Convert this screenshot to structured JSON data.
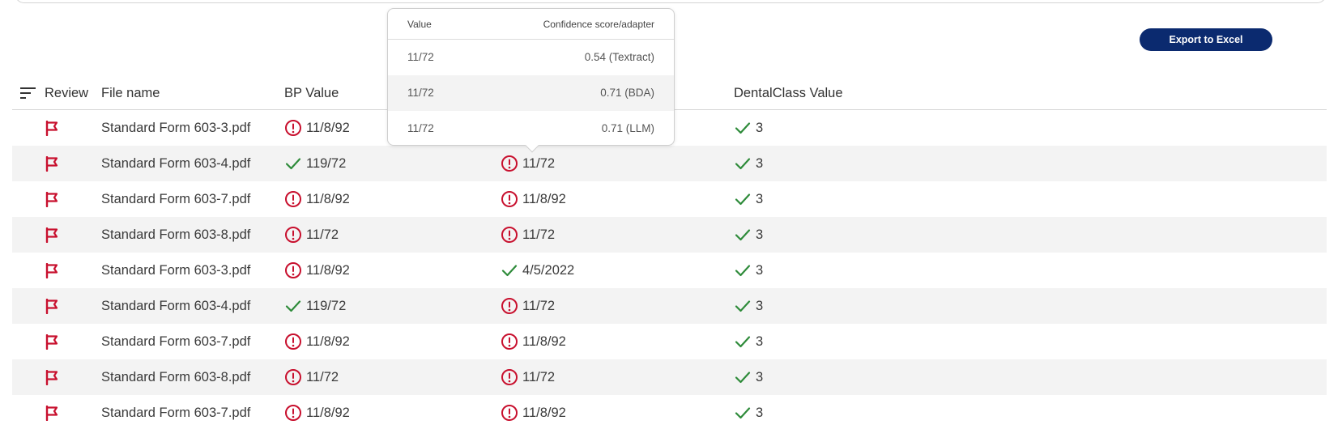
{
  "toolbar": {
    "export_label": "Export to Excel"
  },
  "colors": {
    "accent": "#0b2a6f",
    "flag": "#c8102e",
    "warning": "#c8102e",
    "success": "#2e8b3a"
  },
  "table": {
    "headers": {
      "review": "Review",
      "file_name": "File name",
      "bp_value": "BP Value",
      "dentalclass_value": "DentalClass Value"
    },
    "rows": [
      {
        "file": "Standard Form 603-3.pdf",
        "bp": {
          "status": "warning",
          "text": "11/8/92"
        },
        "col3": {
          "status": "",
          "text": ""
        },
        "dental": {
          "status": "success",
          "text": "3"
        }
      },
      {
        "file": "Standard Form 603-4.pdf",
        "bp": {
          "status": "success",
          "text": "119/72"
        },
        "col3": {
          "status": "warning",
          "text": "11/72"
        },
        "dental": {
          "status": "success",
          "text": "3"
        }
      },
      {
        "file": "Standard Form 603-7.pdf",
        "bp": {
          "status": "warning",
          "text": "11/8/92"
        },
        "col3": {
          "status": "warning",
          "text": "11/8/92"
        },
        "dental": {
          "status": "success",
          "text": "3"
        }
      },
      {
        "file": "Standard Form 603-8.pdf",
        "bp": {
          "status": "warning",
          "text": "11/72"
        },
        "col3": {
          "status": "warning",
          "text": "11/72"
        },
        "dental": {
          "status": "success",
          "text": "3"
        }
      },
      {
        "file": "Standard Form 603-3.pdf",
        "bp": {
          "status": "warning",
          "text": "11/8/92"
        },
        "col3": {
          "status": "success",
          "text": "4/5/2022"
        },
        "dental": {
          "status": "success",
          "text": "3"
        }
      },
      {
        "file": "Standard Form 603-4.pdf",
        "bp": {
          "status": "success",
          "text": "119/72"
        },
        "col3": {
          "status": "warning",
          "text": "11/72"
        },
        "dental": {
          "status": "success",
          "text": "3"
        }
      },
      {
        "file": "Standard Form 603-7.pdf",
        "bp": {
          "status": "warning",
          "text": "11/8/92"
        },
        "col3": {
          "status": "warning",
          "text": "11/8/92"
        },
        "dental": {
          "status": "success",
          "text": "3"
        }
      },
      {
        "file": "Standard Form 603-8.pdf",
        "bp": {
          "status": "warning",
          "text": "11/72"
        },
        "col3": {
          "status": "warning",
          "text": "11/72"
        },
        "dental": {
          "status": "success",
          "text": "3"
        }
      },
      {
        "file": "Standard Form 603-7.pdf",
        "bp": {
          "status": "warning",
          "text": "11/8/92"
        },
        "col3": {
          "status": "warning",
          "text": "11/8/92"
        },
        "dental": {
          "status": "success",
          "text": "3"
        }
      }
    ]
  },
  "tooltip": {
    "header_value": "Value",
    "header_confidence": "Confidence score/adapter",
    "rows": [
      {
        "value": "11/72",
        "confidence": "0.54 (Textract)"
      },
      {
        "value": "11/72",
        "confidence": "0.71 (BDA)"
      },
      {
        "value": "11/72",
        "confidence": "0.71 (LLM)"
      }
    ]
  },
  "icons": {
    "sort": "sort-icon",
    "flag": "flag-icon",
    "warning": "warning-circle-icon",
    "success": "checkmark-icon"
  }
}
